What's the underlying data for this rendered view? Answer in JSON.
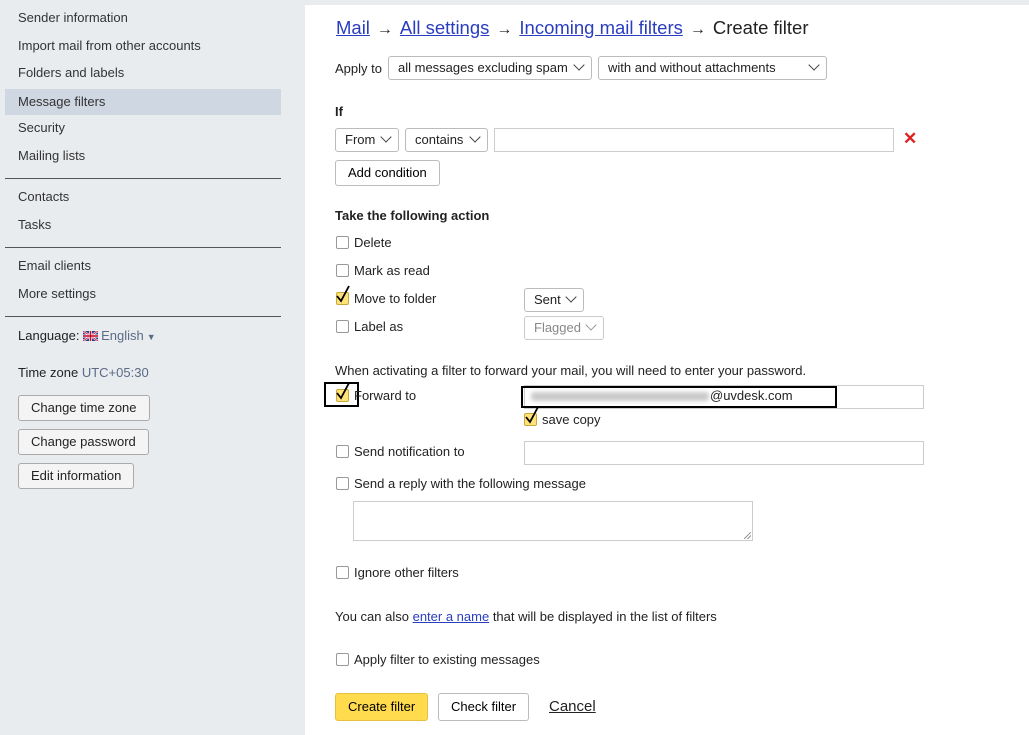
{
  "sidebar": {
    "items": [
      {
        "label": "Sender information",
        "active": false
      },
      {
        "label": "Import mail from other accounts",
        "active": false
      },
      {
        "label": "Folders and labels",
        "active": false
      },
      {
        "label": "Message filters",
        "active": true
      },
      {
        "label": "Security",
        "active": false
      },
      {
        "label": "Mailing lists",
        "active": false
      },
      {
        "label": "Contacts",
        "active": false
      },
      {
        "label": "Tasks",
        "active": false
      },
      {
        "label": "Email clients",
        "active": false
      },
      {
        "label": "More settings",
        "active": false
      }
    ],
    "language_label": "Language:",
    "language_value": "English",
    "timezone_label": "Time zone",
    "timezone_value": "UTC+05:30",
    "buttons": {
      "change_timezone": "Change time zone",
      "change_password": "Change password",
      "edit_information": "Edit information"
    }
  },
  "breadcrumb": {
    "mail": "Mail",
    "all_settings": "All settings",
    "incoming_filters": "Incoming mail filters",
    "current": "Create filter",
    "arrow": "→"
  },
  "apply_to": {
    "label": "Apply to",
    "scope": "all messages excluding spam",
    "attachments": "with and without attachments"
  },
  "if_section": {
    "heading": "If",
    "field": "From",
    "operator": "contains",
    "value": "",
    "add_condition": "Add condition",
    "remove_icon": "✕"
  },
  "actions": {
    "heading": "Take the following action",
    "delete": {
      "label": "Delete",
      "checked": false
    },
    "mark_read": {
      "label": "Mark as read",
      "checked": false
    },
    "move_folder": {
      "label": "Move to folder",
      "checked": true,
      "folder": "Sent"
    },
    "label_as": {
      "label": "Label as",
      "checked": false,
      "value": "Flagged"
    }
  },
  "forward": {
    "notice": "When activating a filter to forward your mail, you will need to enter your password.",
    "label": "Forward to",
    "checked": true,
    "email_suffix": "@uvdesk.com",
    "save_copy": {
      "label": "save copy",
      "checked": true
    }
  },
  "notification": {
    "label": "Send notification to",
    "checked": false,
    "value": ""
  },
  "reply": {
    "label": "Send a reply with the following message",
    "checked": false,
    "value": ""
  },
  "ignore_filters": {
    "label": "Ignore other filters",
    "checked": false
  },
  "name_note": {
    "before": "You can also ",
    "link": "enter a name",
    "after": " that will be displayed in the list of filters"
  },
  "apply_existing": {
    "label": "Apply filter to existing messages",
    "checked": false
  },
  "footer": {
    "create": "Create filter",
    "check": "Check filter",
    "cancel": "Cancel"
  },
  "colors": {
    "primary_button": "#ffdb4d",
    "link": "#2a3dbf",
    "sidebar_bg": "#e9ecef",
    "active_item": "#cfd7e2",
    "remove": "#e02020"
  }
}
